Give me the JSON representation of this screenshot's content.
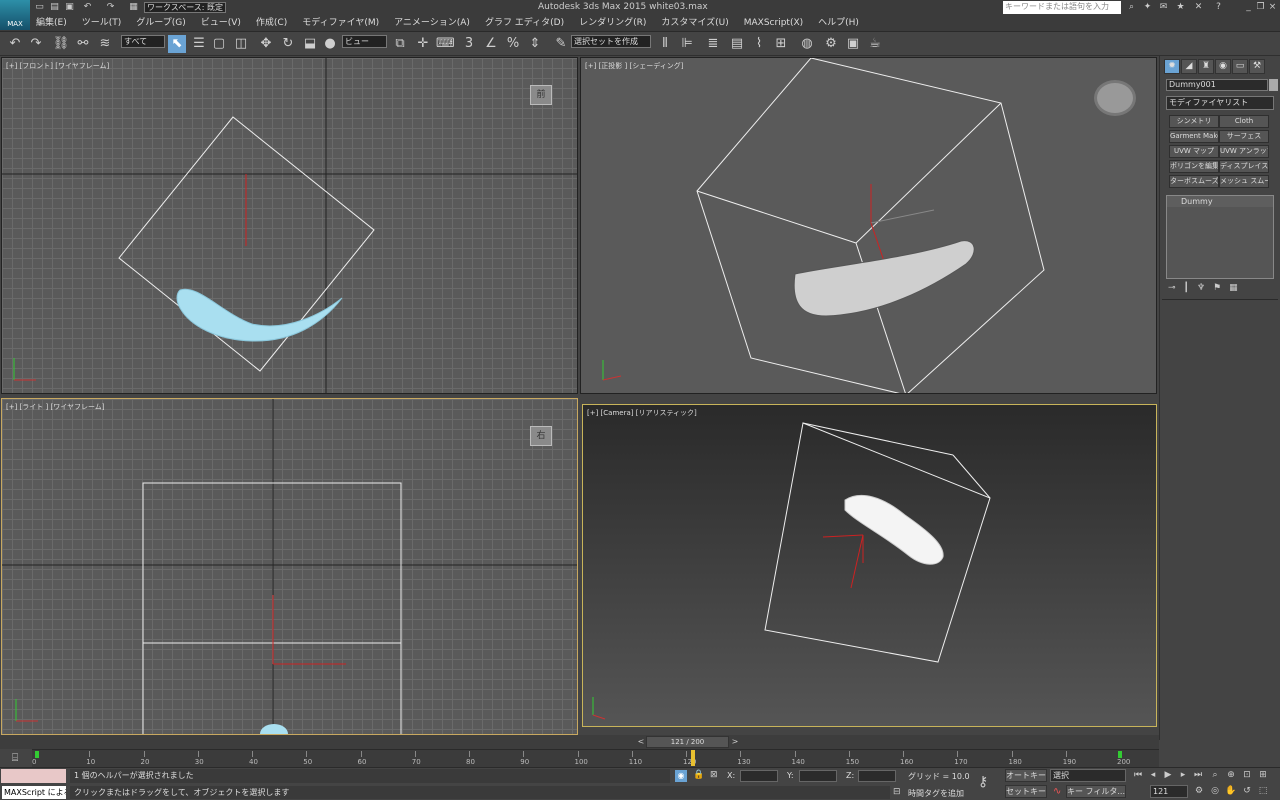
{
  "app": {
    "logo": "MAX",
    "title": "Autodesk 3ds Max  2015     white03.max",
    "workspace": "ワークスペース: 既定",
    "search_placeholder": "キーワードまたは語句を入力"
  },
  "menu": [
    "編集(E)",
    "ツール(T)",
    "グループ(G)",
    "ビュー(V)",
    "作成(C)",
    "モディファイヤ(M)",
    "アニメーション(A)",
    "グラフ エディタ(D)",
    "レンダリング(R)",
    "カスタマイズ(U)",
    "MAXScript(X)",
    "ヘルプ(H)"
  ],
  "toolbar": {
    "filter": "すべて",
    "coord": "ビュー",
    "named_selection": "選択セットを作成"
  },
  "viewports": {
    "front": {
      "label": "[+] [フロント] [ワイヤフレーム]",
      "cube": "前"
    },
    "persp": {
      "label": "[+] [正投影 ] [シェーディング]"
    },
    "right": {
      "label": "[+] [ライト ] [ワイヤフレーム]",
      "cube": "右"
    },
    "camera": {
      "label": "[+] [Camera] [リアリスティック]"
    }
  },
  "cmdpanel": {
    "object_name": "Dummy001",
    "modifier_list": "モディファイヤリスト",
    "modifiers": [
      "シンメトリ",
      "Cloth",
      "Garment Maker",
      "サーフェス",
      "UVW マップ",
      "UVW アンラップ",
      "ポリゴンを編集",
      "ディスプレイス",
      "ターボスムーズ",
      "メッシュ スムーズ"
    ],
    "stack_item": "Dummy"
  },
  "timeline": {
    "frame_display": "121 / 200",
    "ticks": [
      "0",
      "10",
      "20",
      "30",
      "40",
      "50",
      "60",
      "70",
      "80",
      "90",
      "100",
      "110",
      "120",
      "130",
      "140",
      "150",
      "160",
      "170",
      "180",
      "190",
      "200"
    ]
  },
  "status": {
    "maxscript": "MAXScript による",
    "selection_msg": "1 個のヘルパーが選択されました",
    "prompt": "クリックまたはドラッグをして、オブジェクトを選択します",
    "x_label": "X:",
    "y_label": "Y:",
    "z_label": "Z:",
    "grid": "グリッド = 10.0",
    "add_time_tag": "時間タグを追加",
    "auto_key": "オートキー",
    "set_key": "セットキー",
    "key_mode": "選択",
    "key_filter": "キー フィルタ...",
    "current_frame": "121"
  }
}
